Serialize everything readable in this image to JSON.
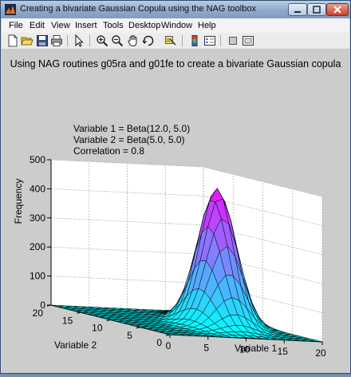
{
  "window": {
    "title": "Creating a bivariate Gaussian Copula using the NAG toolbox",
    "controls": [
      "minimize",
      "maximize",
      "close"
    ]
  },
  "menubar": {
    "items": [
      "File",
      "Edit",
      "View",
      "Insert",
      "Tools",
      "Desktop",
      "Window",
      "Help"
    ]
  },
  "toolbar": {
    "icons": [
      "new-figure-icon",
      "open-file-icon",
      "save-icon",
      "print-icon",
      "edit-plot-arrow-icon",
      "zoom-in-icon",
      "zoom-out-icon",
      "pan-hand-icon",
      "rotate-3d-icon",
      "data-cursor-icon",
      "colorbar-icon",
      "legend-icon",
      "hide-plot-tools-icon",
      "show-plot-tools-icon"
    ]
  },
  "chart_data": {
    "type": "surface3d",
    "title": "Using NAG routines g05ra and g01fe to create a bivariate Gaussian copula",
    "xlabel": "Variable 1",
    "ylabel": "Variable 2",
    "zlabel": "Frequency",
    "xlim": [
      0,
      20
    ],
    "ylim": [
      0,
      20
    ],
    "zlim": [
      0,
      500
    ],
    "xticks": [
      "0",
      "5",
      "10",
      "15",
      "20"
    ],
    "yticks": [
      "0",
      "5",
      "10",
      "15",
      "20"
    ],
    "zticks": [
      "0",
      "100",
      "200",
      "300",
      "400",
      "500"
    ],
    "annotation": [
      "Variable 1 = Beta(12.0, 5.0)",
      "Variable 2 = Beta(5.0, 5.0)",
      "Correlation = 0.8"
    ],
    "grid": true,
    "colormap": "cool",
    "surface": {
      "grid_size": 21,
      "peak_frequency": 470,
      "peak_variable1": 14,
      "peak_variable2": 10
    }
  }
}
